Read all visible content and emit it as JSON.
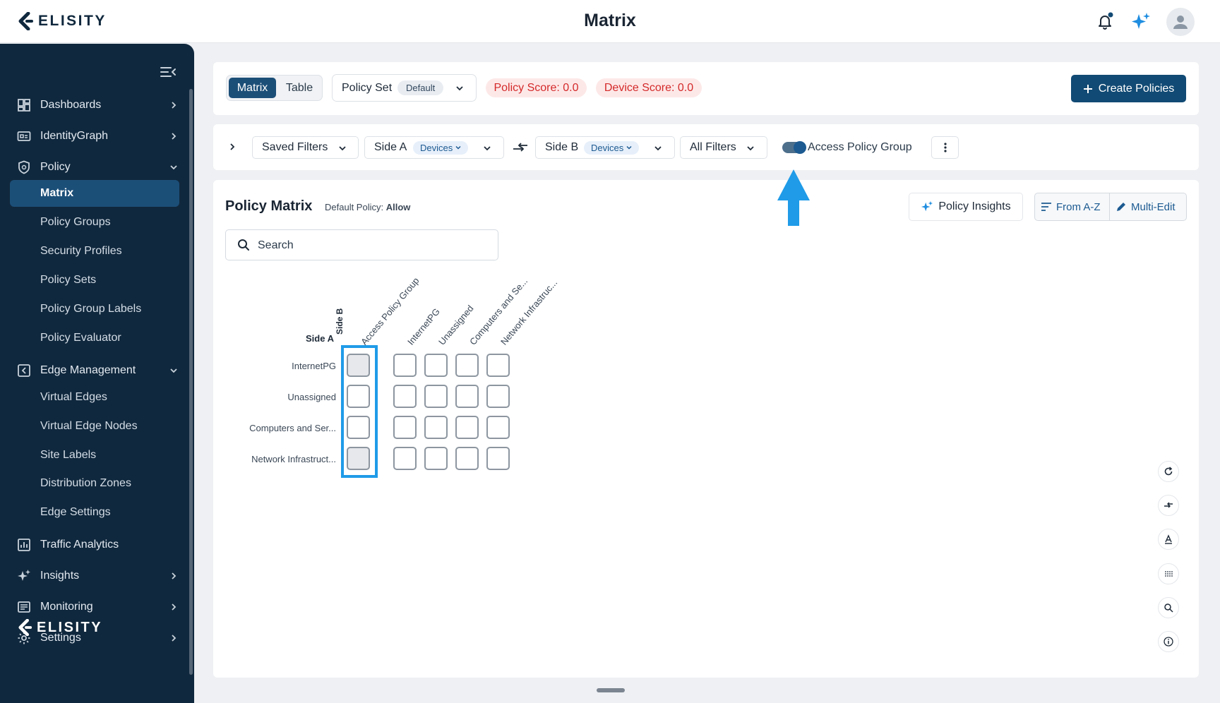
{
  "header": {
    "brand": "ELISITY",
    "page_title": "Matrix"
  },
  "sidebar": {
    "items": [
      {
        "label": "Dashboards",
        "icon": "dashboard-icon"
      },
      {
        "label": "IdentityGraph",
        "icon": "identity-graph-icon"
      },
      {
        "label": "Policy",
        "icon": "shield-icon"
      },
      {
        "label": "Edge Management",
        "icon": "edge-icon"
      },
      {
        "label": "Traffic Analytics",
        "icon": "chart-icon"
      },
      {
        "label": "Insights",
        "icon": "sparkle-icon"
      },
      {
        "label": "Monitoring",
        "icon": "monitor-icon"
      },
      {
        "label": "Settings",
        "icon": "gear-icon"
      }
    ],
    "policy_sub": [
      "Matrix",
      "Policy Groups",
      "Security Profiles",
      "Policy Sets",
      "Policy Group Labels",
      "Policy Evaluator"
    ],
    "edge_sub": [
      "Virtual Edges",
      "Virtual Edge Nodes",
      "Site Labels",
      "Distribution Zones",
      "Edge Settings"
    ],
    "active": "Matrix",
    "footer_brand": "ELISITY"
  },
  "toolbar": {
    "view_matrix": "Matrix",
    "view_table": "Table",
    "policy_set_label": "Policy Set",
    "policy_set_value": "Default",
    "policy_score": "Policy Score: 0.0",
    "device_score": "Device Score: 0.0",
    "create_policies": "Create Policies"
  },
  "filters": {
    "saved_filters": "Saved Filters",
    "side_a_label": "Side A",
    "side_a_value": "Devices",
    "side_b_label": "Side B",
    "side_b_value": "Devices",
    "all_filters": "All Filters",
    "toggle_label": "Access Policy Group",
    "toggle_on": true
  },
  "matrix": {
    "title": "Policy Matrix",
    "default_policy_label": "Default Policy:",
    "default_policy_value": "Allow",
    "policy_insights": "Policy Insights",
    "sort": "From A-Z",
    "multi_edit": "Multi-Edit",
    "search_placeholder": "Search",
    "side_a": "Side A",
    "side_b": "Side B",
    "columns": [
      "Access Policy Group",
      "InternetPG",
      "Unassigned",
      "Computers and Se...",
      "Network Infrastruc..."
    ],
    "rows": [
      "InternetPG",
      "Unassigned",
      "Computers and Ser...",
      "Network Infrastruct..."
    ],
    "highlight_color": "#1f9be8"
  },
  "colors": {
    "accent": "#114a74",
    "sidebar_bg": "#10283d",
    "score_bg": "#fde8e8",
    "score_text": "#d42a2a"
  }
}
